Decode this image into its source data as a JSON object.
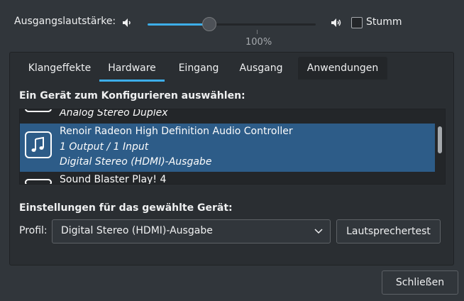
{
  "volume": {
    "label": "Ausgangslautstärke:",
    "level_percent": 37,
    "readout": "100%",
    "left_icon": "speaker-icon",
    "right_icon": "speaker-loud-icon",
    "mute_label": "Stumm",
    "mute_checked": false
  },
  "tabs": [
    {
      "label": "Klangeffekte"
    },
    {
      "label": "Hardware",
      "active": true
    },
    {
      "label": "Eingang"
    },
    {
      "label": "Ausgang"
    },
    {
      "label": "Anwendungen"
    }
  ],
  "device_section_title": "Ein Gerät zum Konfigurieren auswählen:",
  "devices": {
    "prev_tail": "Analog Stereo Duplex",
    "selected": {
      "name": "Renoir Radeon High Definition Audio Controller",
      "io": "1 Output / 1 Input",
      "profile": "Digital Stereo (HDMI)-Ausgabe",
      "icon": "music-note-icon"
    },
    "next_head": "Sound Blaster Play! 4"
  },
  "settings": {
    "title": "Einstellungen für das gewählte Gerät:",
    "profile_label": "Profil:",
    "profile_value": "Digital Stereo (HDMI)-Ausgabe",
    "speaker_test_label": "Lautsprechertest"
  },
  "close_label": "Schließen",
  "colors": {
    "background": "#31363b",
    "accent": "#3daee9",
    "selection": "#2d5c88"
  }
}
